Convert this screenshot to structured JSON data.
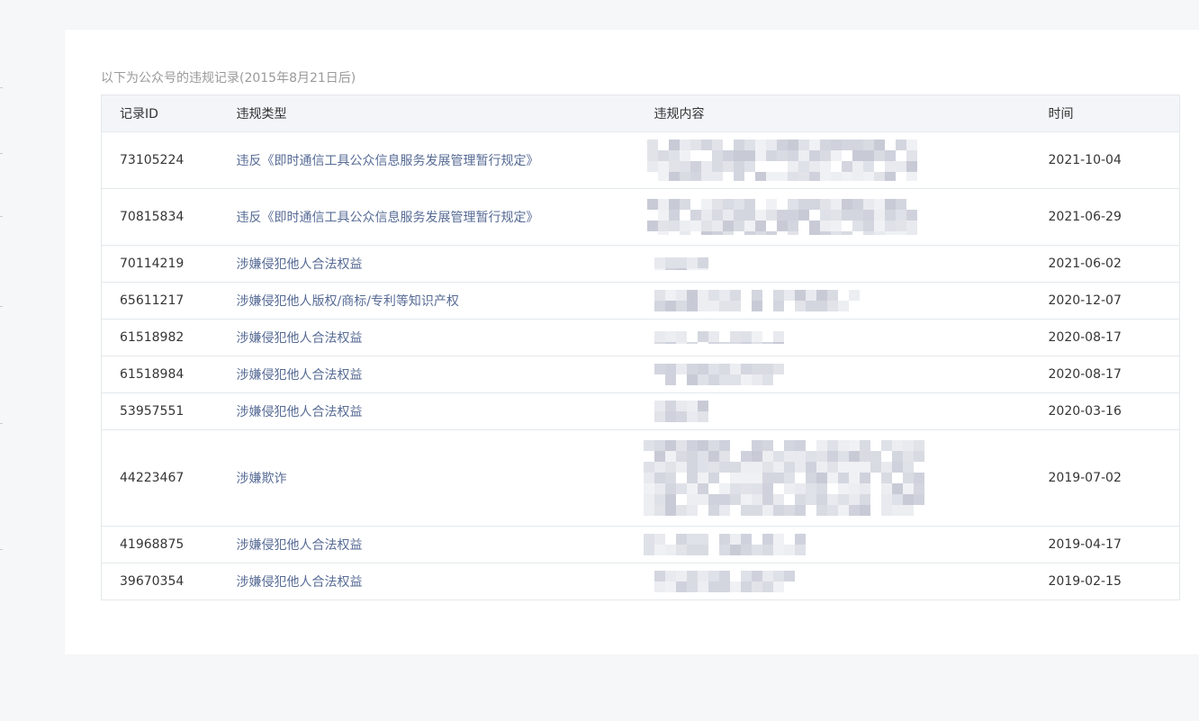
{
  "notice": "以下为公众号的违规记录(2015年8月21日后)",
  "table": {
    "headers": {
      "id": "记录ID",
      "type": "违规类型",
      "content": "违规内容",
      "time": "时间"
    },
    "rows": [
      {
        "id": "73105224",
        "type": "违反《即时通信工具公众信息服务发展管理暂行规定》",
        "time": "2021-10-04"
      },
      {
        "id": "70815834",
        "type": "违反《即时通信工具公众信息服务发展管理暂行规定》",
        "time": "2021-06-29"
      },
      {
        "id": "70114219",
        "type": "涉嫌侵犯他人合法权益",
        "time": "2021-06-02"
      },
      {
        "id": "65611217",
        "type": "涉嫌侵犯他人版权/商标/专利等知识产权",
        "time": "2020-12-07"
      },
      {
        "id": "61518982",
        "type": "涉嫌侵犯他人合法权益",
        "time": "2020-08-17"
      },
      {
        "id": "61518984",
        "type": "涉嫌侵犯他人合法权益",
        "time": "2020-08-17"
      },
      {
        "id": "53957551",
        "type": "涉嫌侵犯他人合法权益",
        "time": "2020-03-16"
      },
      {
        "id": "44223467",
        "type": "涉嫌欺诈",
        "time": "2019-07-02"
      },
      {
        "id": "41968875",
        "type": "涉嫌侵犯他人合法权益",
        "time": "2019-04-17"
      },
      {
        "id": "39670354",
        "type": "涉嫌侵犯他人合法权益",
        "time": "2019-02-15"
      }
    ]
  }
}
